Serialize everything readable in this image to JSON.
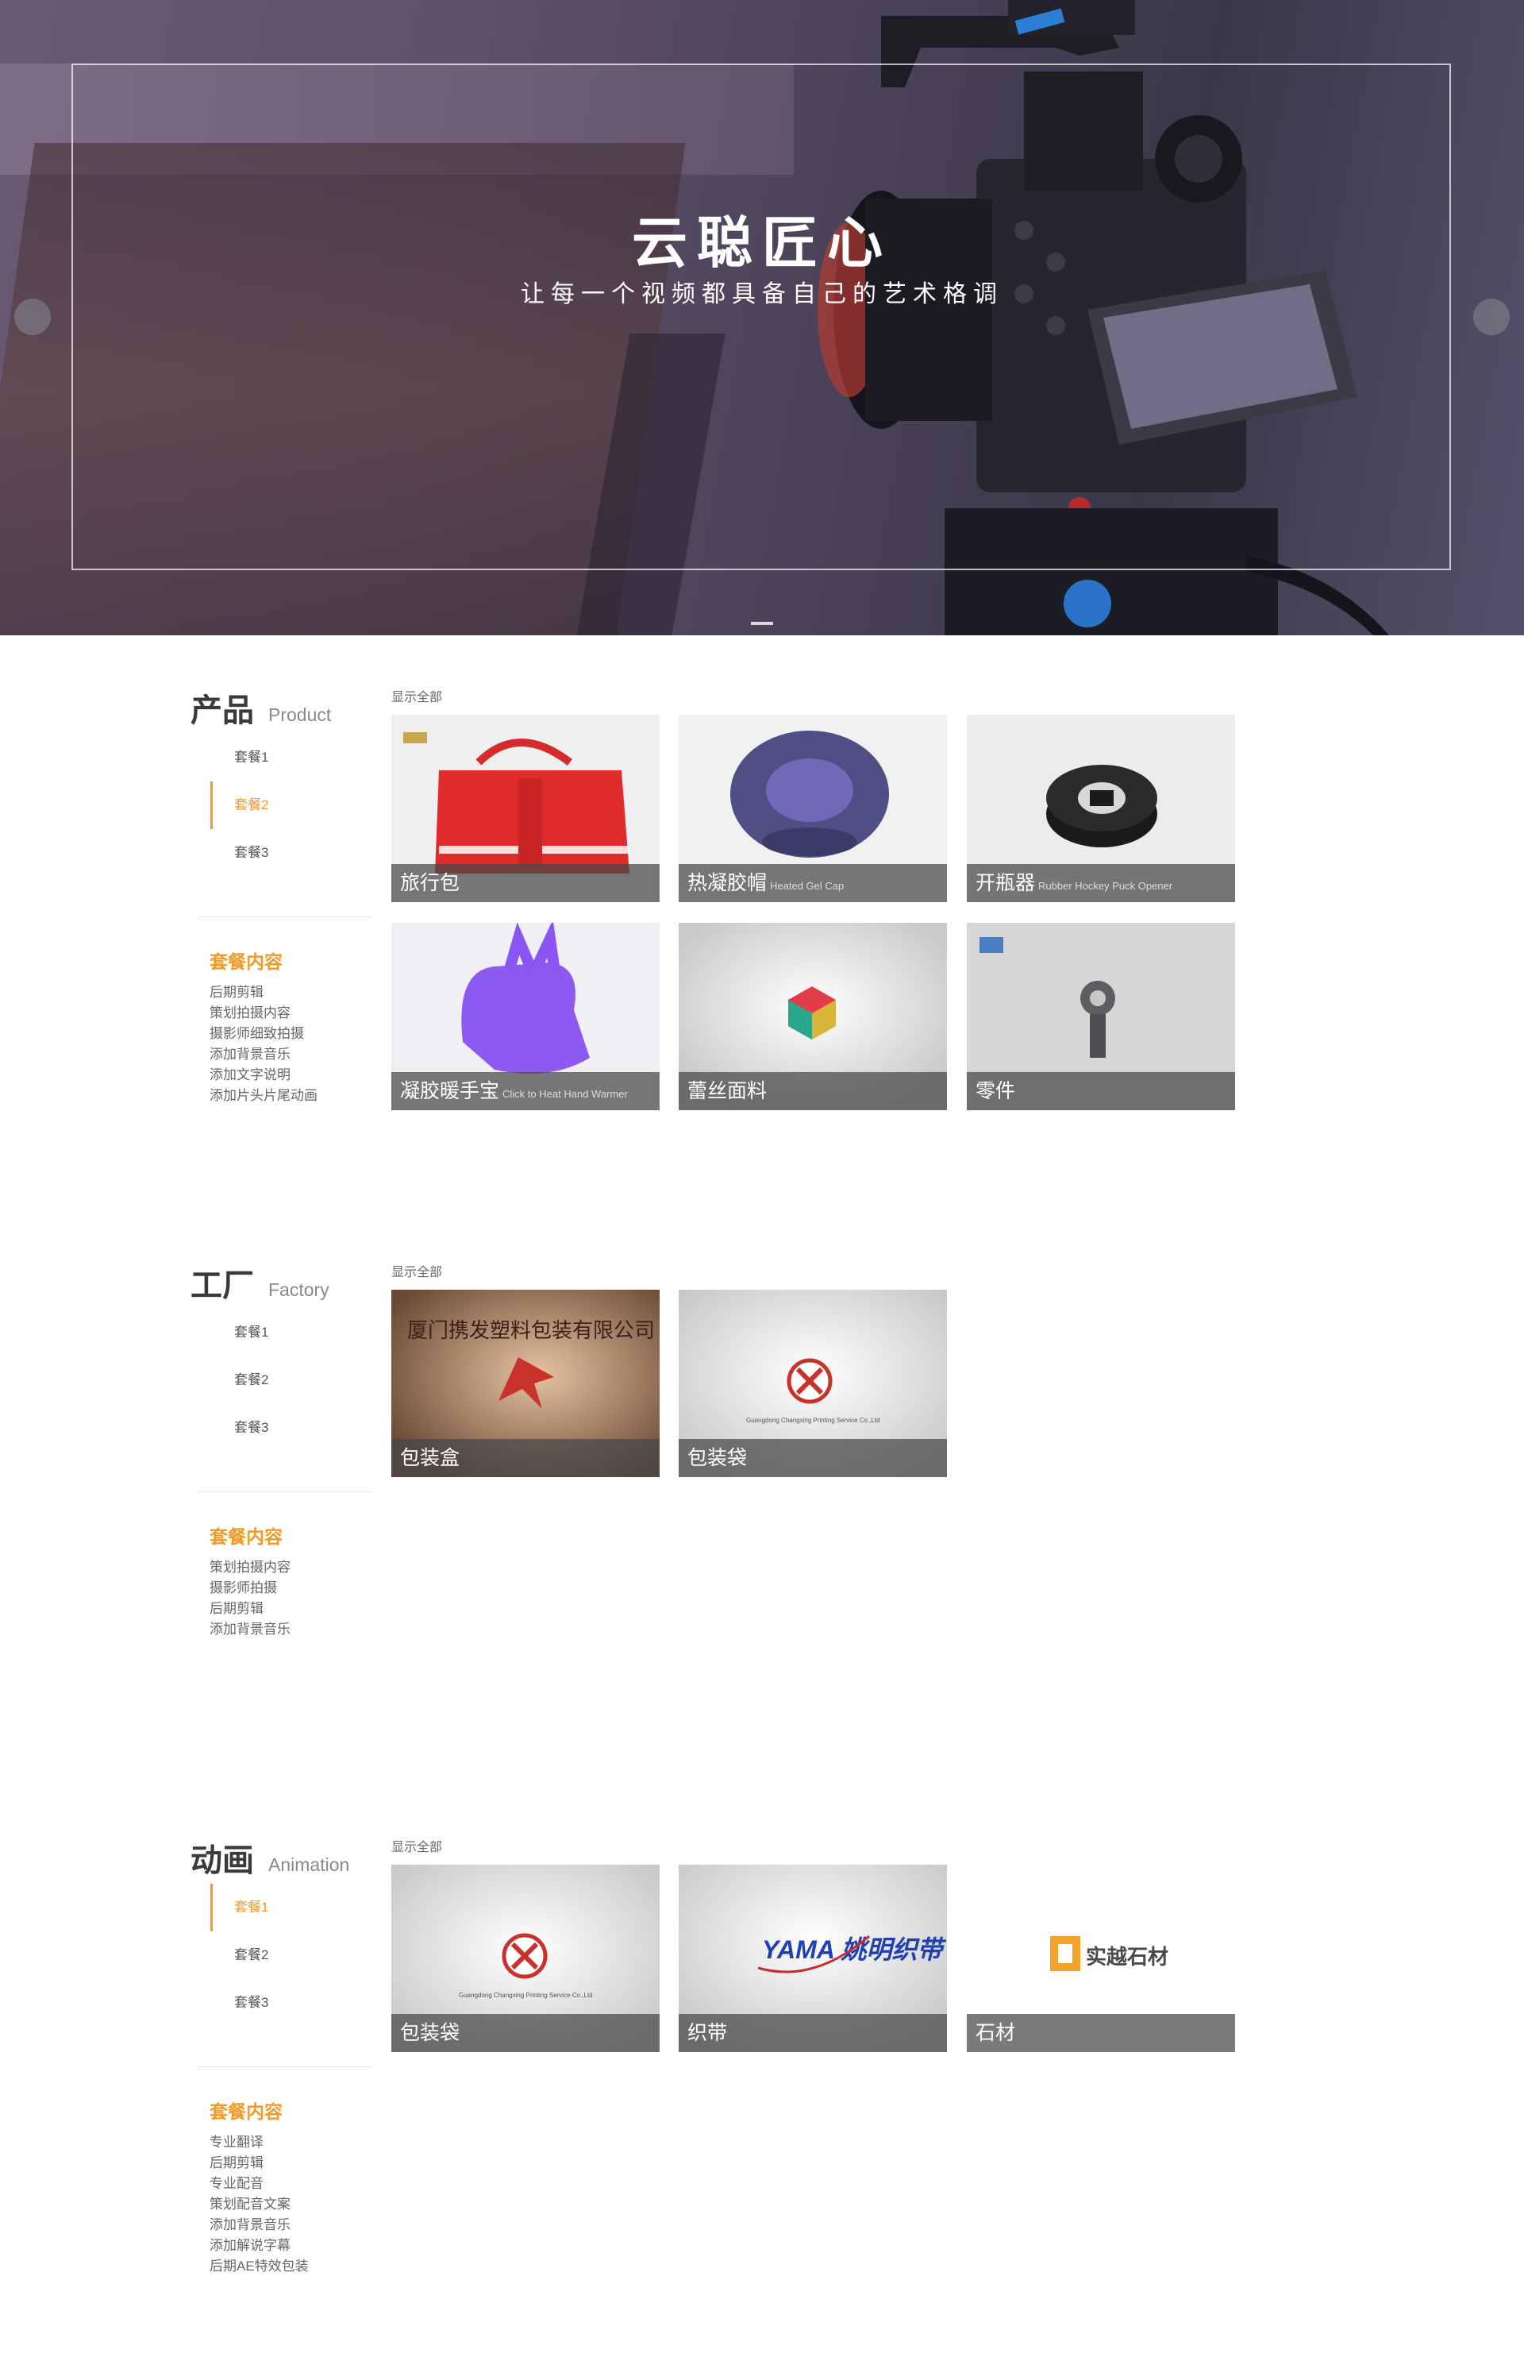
{
  "hero": {
    "title": "云聪匠心",
    "subtitle": "让每一个视频都具备自己的艺术格调"
  },
  "sections": [
    {
      "title_cn": "产品",
      "title_en": "Product",
      "menu": [
        "套餐1",
        "套餐2",
        "套餐3"
      ],
      "active_menu": "套餐2",
      "package_title": "套餐内容",
      "package_items": [
        "后期剪辑",
        "策划拍摄内容",
        "摄影师细致拍摄",
        "添加背景音乐",
        "添加文字说明",
        "添加片头片尾动画"
      ],
      "show_all": "显示全部",
      "cards": [
        {
          "caption": "旅行包",
          "tag": ""
        },
        {
          "caption": "热凝胶帽",
          "tag": "Heated Gel Cap"
        },
        {
          "caption": "开瓶器",
          "tag": "Rubber Hockey Puck Opener"
        },
        {
          "caption": "凝胶暖手宝",
          "tag": "Click to Heat Hand Warmer"
        },
        {
          "caption": "蕾丝面料",
          "tag": ""
        },
        {
          "caption": "零件",
          "tag": ""
        }
      ]
    },
    {
      "title_cn": "工厂",
      "title_en": "Factory",
      "menu": [
        "套餐1",
        "套餐2",
        "套餐3"
      ],
      "active_menu": "",
      "package_title": "套餐内容",
      "package_items": [
        "策划拍摄内容",
        "摄影师拍摄",
        "后期剪辑",
        "添加背景音乐"
      ],
      "show_all": "显示全部",
      "cards": [
        {
          "caption": "包装盒",
          "tag": "",
          "sign": "厦门携发塑料包装有限公司"
        },
        {
          "caption": "包装袋",
          "tag": "",
          "logo_text": "Guangdong Changxing Printing Service Co.,Ltd"
        }
      ]
    },
    {
      "title_cn": "动画",
      "title_en": "Animation",
      "menu": [
        "套餐1",
        "套餐2",
        "套餐3"
      ],
      "active_menu": "套餐1",
      "package_title": "套餐内容",
      "package_items": [
        "专业翻译",
        "后期剪辑",
        "专业配音",
        "策划配音文案",
        "添加背景音乐",
        "添加解说字幕",
        "后期AE特效包装"
      ],
      "show_all": "显示全部",
      "cards": [
        {
          "caption": "包装袋",
          "tag": "",
          "logo_text": "Guangdong Changxing Printing Service Co.,Ltd"
        },
        {
          "caption": "织带",
          "tag": "",
          "logo_text": "YAMA 姚明织带"
        },
        {
          "caption": "石材",
          "tag": "",
          "logo_text": "实越石材"
        }
      ]
    }
  ],
  "colors": {
    "accent": "#f29a24",
    "caption_bg": "#464646",
    "text": "#333333"
  }
}
